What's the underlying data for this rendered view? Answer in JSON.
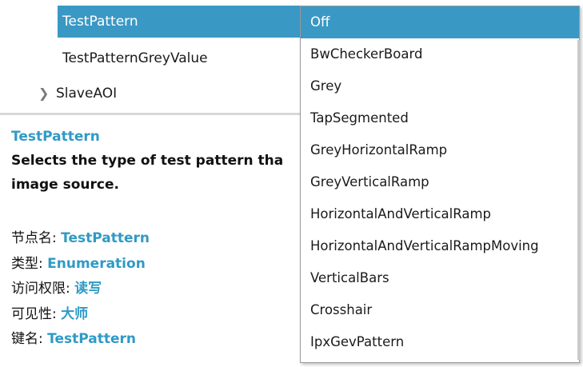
{
  "tree": {
    "selected_label": "TestPattern",
    "item2_label": "TestPatternGreyValue",
    "item3_label": "SlaveAOI",
    "item3_chevron": "chevron-right-icon"
  },
  "description": {
    "title": "TestPattern",
    "text_line1": "Selects the type of test pattern tha",
    "text_line2": "image source."
  },
  "properties": [
    {
      "key": "节点名: ",
      "value": "TestPattern"
    },
    {
      "key": "类型: ",
      "value": "Enumeration"
    },
    {
      "key": "访问权限: ",
      "value": "读写"
    },
    {
      "key": "可见性: ",
      "value": "大师"
    },
    {
      "key": "键名: ",
      "value": "TestPattern"
    }
  ],
  "dropdown": {
    "selected": "Off",
    "options": [
      "Off",
      "BwCheckerBoard",
      "Grey",
      "TapSegmented",
      "GreyHorizontalRamp",
      "GreyVerticalRamp",
      "HorizontalAndVerticalRamp",
      "HorizontalAndVerticalRampMoving",
      "VerticalBars",
      "Crosshair",
      "IpxGevPattern"
    ]
  },
  "colors": {
    "accent": "#3a98c4",
    "link": "#2f9ac6"
  }
}
